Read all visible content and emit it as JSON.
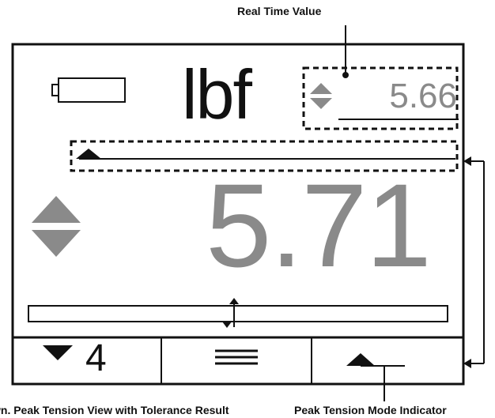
{
  "annotations": {
    "real_time_value": "Real Time Value",
    "peak_tension_view": "wn. Peak Tension View with Tolerance Result",
    "peak_tension_mode": "Peak Tension Mode Indicator"
  },
  "display": {
    "unit": "lbf",
    "real_time_value": "5.66",
    "peak_value": "5.71",
    "footer_count": "4"
  },
  "icons": {
    "battery": "battery-icon",
    "up_down_small": "up-down-arrows-icon",
    "up_down_large": "up-down-arrows-icon",
    "tolerance_marker": "up-down-marker-icon",
    "down_arrow": "down-triangle-icon",
    "menu": "menu-icon",
    "peak_mode": "up-triangle-icon"
  },
  "colors": {
    "value_gray": "#8a8a8a",
    "frame": "#111111"
  }
}
